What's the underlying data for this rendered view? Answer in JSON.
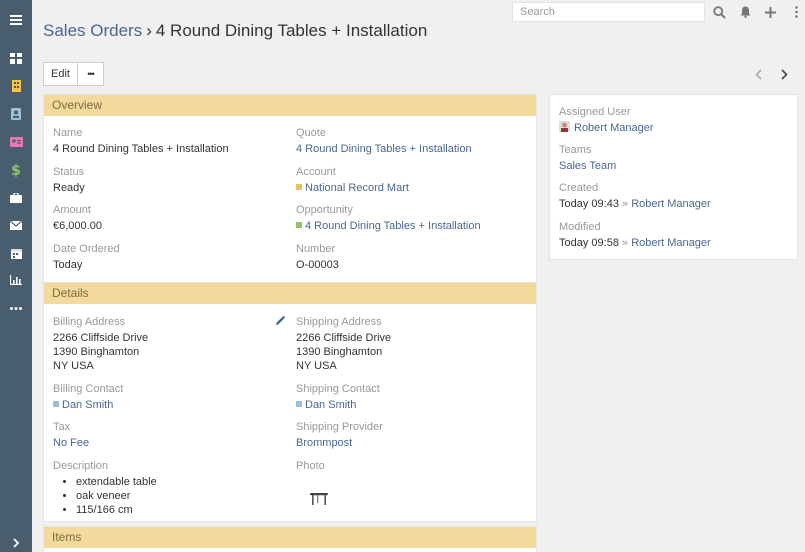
{
  "topbar": {
    "search_placeholder": "Search"
  },
  "breadcrumb": {
    "module": "Sales Orders",
    "separator": "›",
    "record": "4 Round Dining Tables + Installation"
  },
  "toolbar": {
    "edit_label": "Edit",
    "more_label": "•••"
  },
  "overview": {
    "header": "Overview",
    "name_label": "Name",
    "name_value": "4 Round Dining Tables + Installation",
    "quote_label": "Quote",
    "quote_value": "4 Round Dining Tables + Installation",
    "status_label": "Status",
    "status_value": "Ready",
    "account_label": "Account",
    "account_value": "National Record Mart",
    "amount_label": "Amount",
    "amount_value": "€6,000.00",
    "opportunity_label": "Opportunity",
    "opportunity_value": "4 Round Dining Tables + Installation",
    "date_ordered_label": "Date Ordered",
    "date_ordered_value": "Today",
    "number_label": "Number",
    "number_value": "O-00003"
  },
  "details": {
    "header": "Details",
    "billing_address_label": "Billing Address",
    "billing_address_lines": [
      "2266 Cliffside Drive",
      "1390 Binghamton",
      "NY USA"
    ],
    "shipping_address_label": "Shipping Address",
    "shipping_address_lines": [
      "2266 Cliffside Drive",
      "1390 Binghamton",
      "NY USA"
    ],
    "billing_contact_label": "Billing Contact",
    "billing_contact_value": "Dan Smith",
    "shipping_contact_label": "Shipping Contact",
    "shipping_contact_value": "Dan Smith",
    "tax_label": "Tax",
    "tax_value": "No Fee",
    "shipping_provider_label": "Shipping Provider",
    "shipping_provider_value": "Brommpost",
    "description_label": "Description",
    "description_items": [
      "extendable table",
      "oak veneer",
      "115/166 cm"
    ],
    "photo_label": "Photo"
  },
  "items": {
    "header": "Items"
  },
  "side": {
    "assigned_user_label": "Assigned User",
    "assigned_user_value": "Robert Manager",
    "teams_label": "Teams",
    "teams_value": "Sales Team",
    "created_label": "Created",
    "created_time": "Today 09:43",
    "created_by": "Robert Manager",
    "modified_label": "Modified",
    "modified_time": "Today 09:58",
    "modified_by": "Robert Manager",
    "by_separator": "»"
  },
  "colors": {
    "sidebar": "#485d6e",
    "panel_header": "#f3d99c",
    "link": "#4a6792",
    "account_square": "#f0c060",
    "opportunity_square": "#8fc46a",
    "contact_square": "#9ec0d6"
  },
  "sidebar_icons": [
    "menu-icon",
    "dashboard-icon",
    "building-icon",
    "contact-icon",
    "address-card-icon",
    "dollar-icon",
    "briefcase-icon",
    "envelope-icon",
    "calendar-icon",
    "chart-icon",
    "more-icon",
    "chevron-right-icon"
  ]
}
